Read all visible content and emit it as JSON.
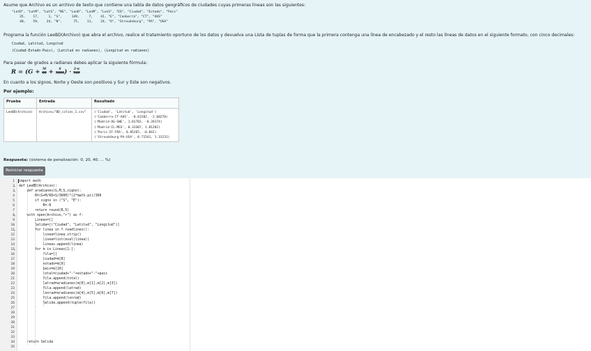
{
  "prompt": {
    "intro": "Asume que Archivo es un archivo de texto que contiene una tabla de datos geográficos de ciudades cuyas primeras líneas son las siguientes:",
    "file_lines": [
      "\"LatD\", \"LatM\", \"LatS\", \"NS\", \"LonD\", \"LonM\", \"LonS\", \"EO\", \"Ciudad\", \"Estado\", \"Pais\"",
      "    35,    17,     1, \"S\",     149,     7,    41, \"E\", \"Canberra\", \"CT\", \"AUS\"",
      "    40,    59,    24, \"N\",      75,    11,    24, \"O\", \"Stroudsburg\", \"PA\", \"USA\""
    ],
    "task": "Programa la función LeeBD(Archivo) que abra el archivo, realice el tratamiento oportuno de los datos y devuelva una Lista de tuplas de forma que la primera contenga una línea de encabezado y el resto las líneas de datos en el siguiente formato, con cinco decimales:",
    "format_lines": [
      "Ciudad, Latitud, Longitud",
      "(Ciudad-Estado-Pais), (Latitud en radianes), (Longitud en radianes)"
    ],
    "formula_intro": "Para pasar de grados a radianes debes aplicar la siguiente fórmula:",
    "formula": {
      "lhs": "R = (G + ",
      "f1_num": "M",
      "f1_den": "60",
      "f2_num": "S",
      "f2_den": "3600",
      "rhs": ") · ",
      "f3_num": "2·π",
      "f3_den": "360"
    },
    "signs": "En cuanto a los signos, Norte y Oeste son positivos y Sur y Este son negativos.",
    "example_label": "Por ejemplo:"
  },
  "example_table": {
    "headers": [
      "Prueba",
      "Entrada",
      "Resultado"
    ],
    "prueba": "LeeBD(Archivo)",
    "entrada": "Archivo=\"BD_cities_1.csv\"",
    "resultado": [
      "('Ciudad', 'Latitud', 'Longitud')",
      "('Canberra-CT-AUS', -0.61582, -2.60278)",
      "('Madrid-OG-SWE', 1.01702, -0.28174)",
      "('Madrid-CL-MEX', 0.33307, 1.81282)",
      "('Paris-IF-FRA', 0.85265, -0.041)",
      "('Stroudsburg-PA-USA', 0.71541, 1.31231)"
    ]
  },
  "answer": {
    "label": "Respuesta:",
    "penalty": "(sistema de penalización: 0, 20, 40, ... %)",
    "reset_button": "Reiniciar respuesta"
  },
  "editor": {
    "lines": [
      "import math",
      "def LeeBD(Archivo):",
      "    def aradianes(G,M,S,signo):",
      "        R=(G+M/60+S/3600)*(2*math.pi)/360",
      "        if signo in (\"S\", \"E\"):",
      "            R=-R",
      "        return round(R,5)",
      "    with open(Archivo,\"r\") as f:",
      "        Lineas=[]",
      "        Salida=[(\"Ciudad\", \"Latitud\", \"Longitud\")]",
      "        for linea in f.readlines():",
      "            linea=linea.strip()",
      "            linea=list(eval(linea))",
      "            Lineas.append(linea)",
      "        for m in Lineas[1:]:",
      "            fila=[]",
      "            ciudad=m[8]",
      "            estado=m[9]",
      "            pais=m[10]",
      "            total=ciudad+\"-\"+estado+\"-\"+pais",
      "            fila.append(total)",
      "            latrad=aradianes(m[0],m[1],m[2],m[3])",
      "            fila.append(latrad)",
      "            lonrad=aradianes(m[4],m[5],m[6],m[7])",
      "            fila.append(lonrad)",
      "            Salida.append(tuple(fila))",
      "",
      "",
      "",
      "",
      "",
      "",
      "",
      "    return Salida",
      ""
    ]
  }
}
